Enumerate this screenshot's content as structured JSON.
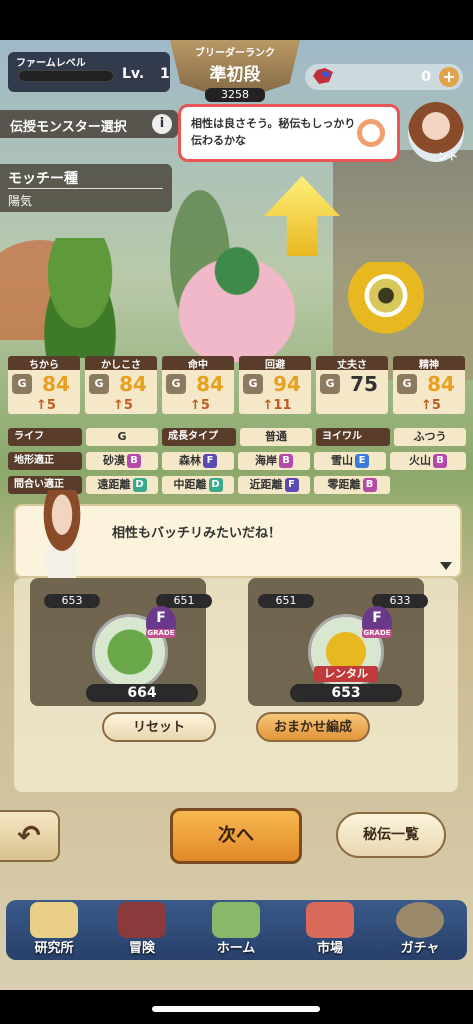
{
  "farm": {
    "label": "ファームレベル",
    "lv_label": "Lv.",
    "lv_value": "1"
  },
  "rank": {
    "title": "ブリーダーランク",
    "value": "準初段",
    "points": "3258"
  },
  "gems": {
    "count": "0",
    "add": "+"
  },
  "inherit": {
    "label": "伝授モンスター選択",
    "info": "i"
  },
  "bubble_top": {
    "text": "相性は良さそう。秘伝もしっかり伝わるかな",
    "avatar_tag": "ント"
  },
  "monster": {
    "name": "モッチー種",
    "trait": "陽気"
  },
  "stats": [
    {
      "label": "ちから",
      "grade": "G",
      "value": "84",
      "delta": "5"
    },
    {
      "label": "かしこさ",
      "grade": "G",
      "value": "84",
      "delta": "5"
    },
    {
      "label": "命中",
      "grade": "G",
      "value": "84",
      "delta": "5"
    },
    {
      "label": "回避",
      "grade": "G",
      "value": "94",
      "delta": "11"
    },
    {
      "label": "丈夫さ",
      "grade": "G",
      "value": "75",
      "delta": ""
    },
    {
      "label": "精神",
      "grade": "G",
      "value": "84",
      "delta": "5"
    }
  ],
  "info1": {
    "life_label": "ライフ",
    "life_val": "G",
    "growth_label": "成長タイプ",
    "growth_val": "普通",
    "yoiwaru_label": "ヨイワル",
    "yoiwaru_val": "ふつう"
  },
  "terrain": {
    "label": "地形適正",
    "items": [
      {
        "name": "砂漠",
        "grade": "B"
      },
      {
        "name": "森林",
        "grade": "F"
      },
      {
        "name": "海岸",
        "grade": "B"
      },
      {
        "name": "雪山",
        "grade": "E"
      },
      {
        "name": "火山",
        "grade": "B"
      }
    ]
  },
  "range": {
    "label": "間合い適正",
    "items": [
      {
        "name": "遠距離",
        "grade": "D"
      },
      {
        "name": "中距離",
        "grade": "D"
      },
      {
        "name": "近距離",
        "grade": "F"
      },
      {
        "name": "零距離",
        "grade": "B"
      }
    ]
  },
  "dialogue": {
    "text": "相性もバッチリみたいだね！"
  },
  "left_panel": {
    "top_a": "653",
    "top_b": "651",
    "main": "664",
    "grade": "F",
    "grade_label": "GRADE"
  },
  "right_panel": {
    "top_a": "651",
    "top_b": "633",
    "main": "653",
    "grade": "F",
    "grade_label": "GRADE",
    "rental": "レンタル"
  },
  "buttons": {
    "reset": "リセット",
    "auto": "おまかせ編成",
    "back": "↶",
    "next": "次へ",
    "secret": "秘伝一覧"
  },
  "tabs": [
    "研究所",
    "冒険",
    "ホーム",
    "市場",
    "ガチャ"
  ],
  "colors": {
    "accent": "#e28a2a",
    "grade_b": "#b24aa8",
    "grade_f": "#5a4ab2",
    "grade_e": "#3a7ad8",
    "grade_d": "#3aa88a"
  }
}
